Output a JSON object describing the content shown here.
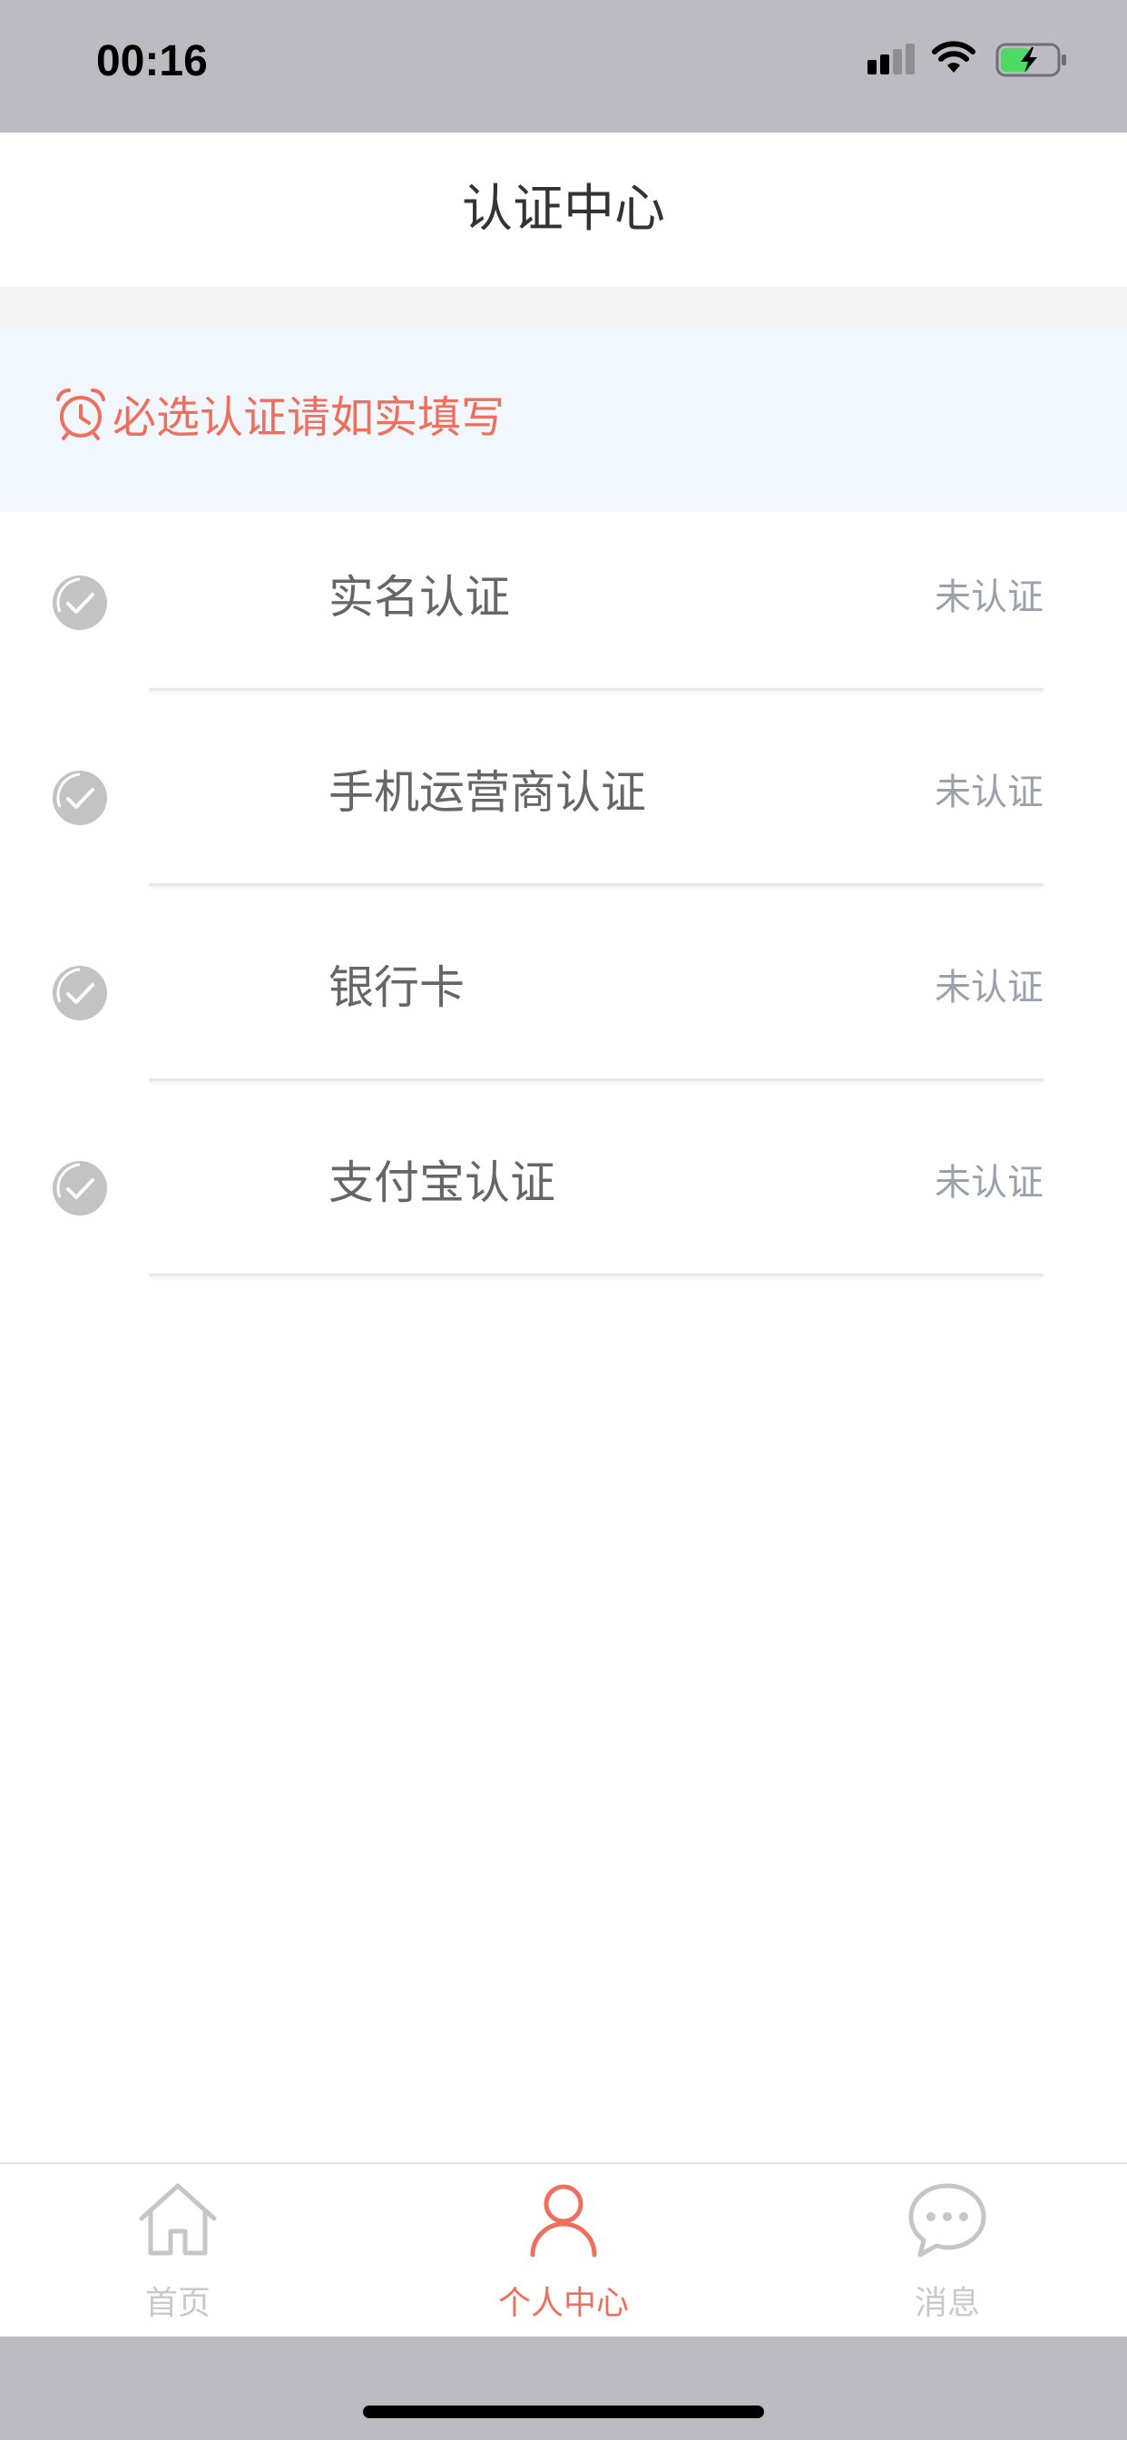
{
  "status_bar": {
    "time": "00:16",
    "icons": [
      "signal-icon",
      "wifi-icon",
      "battery-charging-icon"
    ],
    "battery_color": "#4cd964"
  },
  "nav": {
    "title": "认证中心"
  },
  "notice": {
    "icon": "alarm-clock-icon",
    "text": "必选认证请如实填写",
    "color": "#ef6f5d"
  },
  "auth_items": [
    {
      "label": "实名认证",
      "status": "未认证"
    },
    {
      "label": "手机运营商认证",
      "status": "未认证"
    },
    {
      "label": "银行卡",
      "status": "未认证"
    },
    {
      "label": "支付宝认证",
      "status": "未认证"
    }
  ],
  "tabs": [
    {
      "label": "首页",
      "icon": "home-icon",
      "active": false
    },
    {
      "label": "个人中心",
      "icon": "person-icon",
      "active": true
    },
    {
      "label": "消息",
      "icon": "chat-bubble-icon",
      "active": false
    }
  ],
  "colors": {
    "accent": "#ef6f5d",
    "inactive_tab": "#c9c9c9",
    "status_text": "#9aa1ab",
    "system_bar": "#bcbbc1"
  }
}
